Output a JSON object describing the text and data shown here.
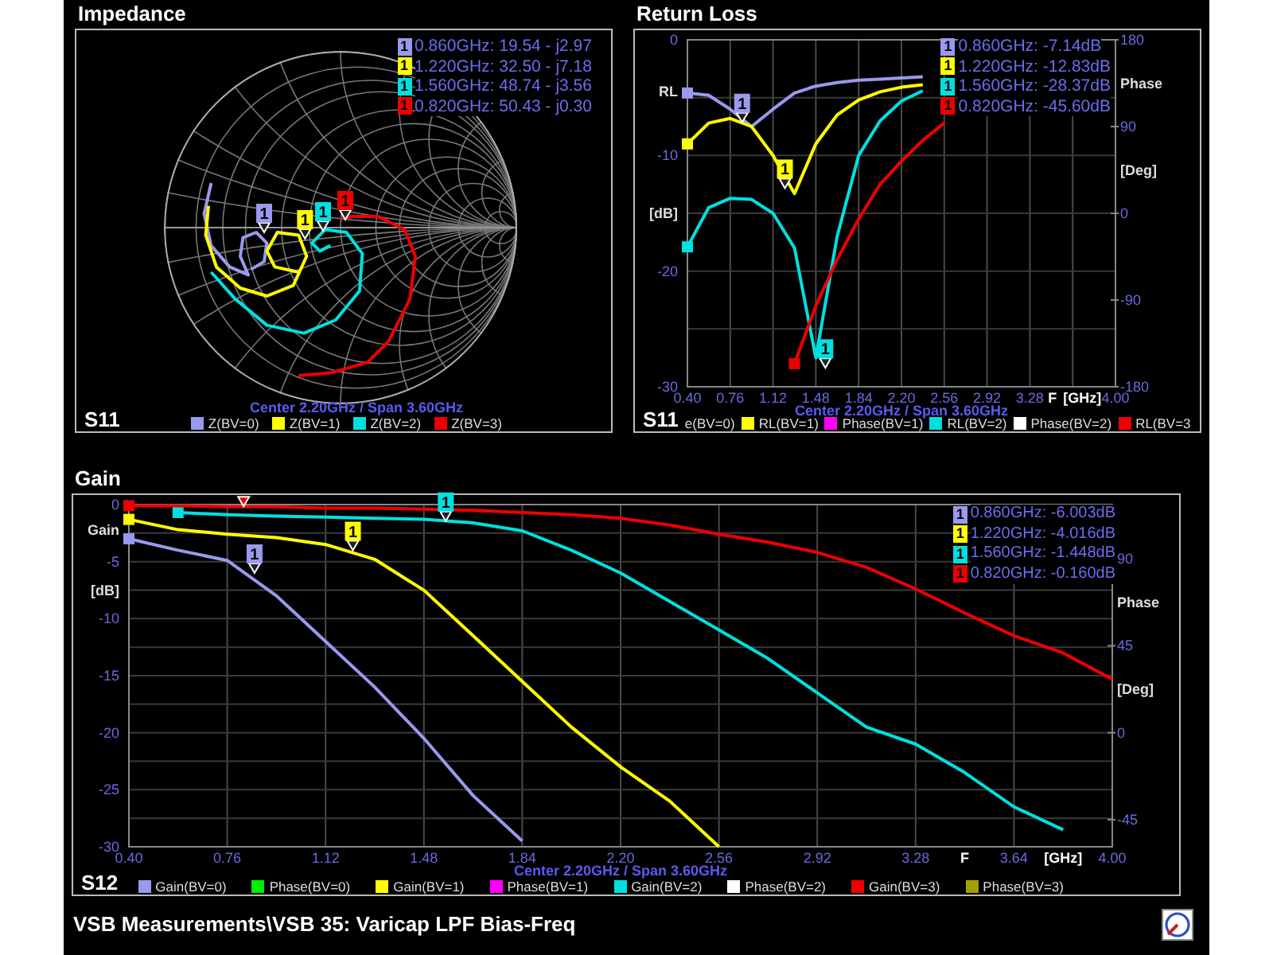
{
  "impedance": {
    "title": "Impedance",
    "param": "S11",
    "readouts": [
      {
        "marker": "1",
        "color": "#9999ee",
        "text": "0.860GHz: 19.54 - j2.97"
      },
      {
        "marker": "1",
        "color": "#ffff00",
        "text": "1.220GHz: 32.50 - j7.18"
      },
      {
        "marker": "1",
        "color": "#00e0e0",
        "text": "1.560GHz: 48.74 - j3.56"
      },
      {
        "marker": "1",
        "color": "#ee0000",
        "text": "0.820GHz: 50.43 - j0.30"
      }
    ],
    "flags": [
      {
        "label": "1",
        "color": "#9999ee"
      },
      {
        "label": "1",
        "color": "#ffff00"
      },
      {
        "label": "1",
        "color": "#00e0e0"
      },
      {
        "label": "1",
        "color": "#ee0000"
      }
    ],
    "span_text": "Center 2.20GHz / Span 3.60GHz",
    "legend": [
      {
        "label": "Z(BV=0)",
        "color": "#9999ee"
      },
      {
        "label": "Z(BV=1)",
        "color": "#ffff00"
      },
      {
        "label": "Z(BV=2)",
        "color": "#00e0e0"
      },
      {
        "label": "Z(BV=3)",
        "color": "#ee0000"
      }
    ]
  },
  "return_loss": {
    "title": "Return Loss",
    "param": "S11",
    "y_symbol": "RL",
    "x_symbol": "F",
    "y2_symbol": "Phase",
    "y2_unit": "[Deg]",
    "readouts": [
      {
        "marker": "1",
        "color": "#9999ee",
        "text": "0.860GHz: -7.14dB"
      },
      {
        "marker": "1",
        "color": "#ffff00",
        "text": "1.220GHz: -12.83dB"
      },
      {
        "marker": "1",
        "color": "#00e0e0",
        "text": "1.560GHz: -28.37dB"
      },
      {
        "marker": "1",
        "color": "#ee0000",
        "text": "0.820GHz: -45.60dB"
      }
    ],
    "flags": [
      {
        "label": "1",
        "color": "#9999ee"
      },
      {
        "label": "1",
        "color": "#ffff00"
      },
      {
        "label": "1",
        "color": "#00e0e0"
      }
    ],
    "span_text": "Center 2.20GHz / Span 3.60GHz",
    "legend": [
      {
        "label": "e(BV=0)"
      },
      {
        "label": "RL(BV=1)",
        "color": "#ffff00"
      },
      {
        "label": "Phase(BV=1)",
        "color": "#ff00ff"
      },
      {
        "label": "RL(BV=2)",
        "color": "#00e0e0"
      },
      {
        "label": "Phase(BV=2)",
        "color": "#ffffff"
      },
      {
        "label": "RL(BV=3",
        "color": "#ee0000"
      }
    ],
    "chart_data": {
      "type": "line",
      "xlabel": "[GHz]",
      "ylabel": "[dB]",
      "grid": true,
      "x": [
        0.4,
        0.58,
        0.76,
        0.94,
        1.12,
        1.3,
        1.48,
        1.66,
        1.84,
        2.02,
        2.2,
        2.38,
        2.56
      ],
      "series": [
        {
          "color": "#9999ee",
          "values": [
            -4.6,
            -4.8,
            -6.0,
            -7.5,
            -6.0,
            -4.6,
            -4.0,
            -3.7,
            -3.5,
            -3.4,
            -3.3,
            -3.2,
            null
          ]
        },
        {
          "color": "#ffff00",
          "values": [
            -9.0,
            -7.2,
            -6.8,
            -7.5,
            -10.0,
            -13.3,
            -9.0,
            -6.5,
            -5.2,
            -4.5,
            -4.1,
            -3.9,
            null
          ]
        },
        {
          "color": "#00e0e0",
          "values": [
            -17.9,
            -14.5,
            -13.7,
            -13.8,
            -15.0,
            -18.0,
            -27.5,
            -17.0,
            -10.0,
            -7.0,
            -5.3,
            -4.4,
            null
          ]
        },
        {
          "color": "#ee0000",
          "values": [
            null,
            null,
            null,
            null,
            null,
            -28.0,
            -23.0,
            -19.0,
            -15.5,
            -12.5,
            -10.5,
            -8.7,
            -7.2
          ]
        }
      ],
      "xlim": [
        0.4,
        4.0
      ],
      "ylim": [
        -30,
        0
      ],
      "xticks": [
        {
          "value": 0.4,
          "label": "0.40"
        },
        {
          "value": 0.76,
          "label": "0.76"
        },
        {
          "value": 1.12,
          "label": "1.12"
        },
        {
          "value": 1.48,
          "label": "1.48"
        },
        {
          "value": 1.84,
          "label": "1.84"
        },
        {
          "value": 2.2,
          "label": "2.20"
        },
        {
          "value": 2.56,
          "label": "2.56"
        },
        {
          "value": 2.92,
          "label": "2.92"
        },
        {
          "value": 3.28,
          "label": "3.28"
        },
        {
          "value": 4.0,
          "label": "4.00"
        }
      ],
      "yticks": [
        0,
        -10,
        -20,
        -30
      ],
      "y2lim": [
        -180,
        180
      ],
      "y2ticks": [
        180,
        90,
        0,
        -90,
        -180
      ]
    }
  },
  "gain": {
    "title": "Gain",
    "param": "S12",
    "y_symbol": "Gain",
    "x_symbol": "F",
    "y2_symbol": "Phase",
    "y2_unit": "[Deg]",
    "readouts": [
      {
        "marker": "1",
        "color": "#9999ee",
        "text": "0.860GHz: -6.003dB"
      },
      {
        "marker": "1",
        "color": "#ffff00",
        "text": "1.220GHz: -4.016dB"
      },
      {
        "marker": "1",
        "color": "#00e0e0",
        "text": "1.560GHz: -1.448dB"
      },
      {
        "marker": "1",
        "color": "#ee0000",
        "text": "0.820GHz: -0.160dB"
      }
    ],
    "flags": [
      {
        "label": "1",
        "color": "#9999ee"
      },
      {
        "label": "1",
        "color": "#ffff00"
      },
      {
        "label": "1",
        "color": "#00e0e0"
      },
      {
        "color": "#ee0000"
      }
    ],
    "span_text": "Center 2.20GHz / Span 3.60GHz",
    "legend": [
      {
        "label": "Gain(BV=0)",
        "color": "#9999ee"
      },
      {
        "label": "Phase(BV=0)",
        "color": "#00ee00"
      },
      {
        "label": "Gain(BV=1)",
        "color": "#ffff00"
      },
      {
        "label": "Phase(BV=1)",
        "color": "#ff00ff"
      },
      {
        "label": "Gain(BV=2)",
        "color": "#00e0e0"
      },
      {
        "label": "Phase(BV=2)",
        "color": "#ffffff"
      },
      {
        "label": "Gain(BV=3)",
        "color": "#ee0000"
      },
      {
        "label": "Phase(BV=3)",
        "color": "#a0a000"
      }
    ],
    "chart_data": {
      "type": "line",
      "xlabel": "[GHz]",
      "ylabel": "[dB]",
      "grid": true,
      "x": [
        0.4,
        0.58,
        0.76,
        0.94,
        1.12,
        1.3,
        1.48,
        1.66,
        1.84,
        2.02,
        2.2,
        2.38,
        2.56,
        2.74,
        2.92,
        3.1,
        3.28,
        3.46,
        3.64,
        3.82,
        4.0
      ],
      "series": [
        {
          "color": "#9999ee",
          "values": [
            -3.0,
            -4.0,
            -4.9,
            -8.0,
            -12.0,
            -16.0,
            -20.5,
            -25.5,
            -29.5,
            null,
            null,
            null,
            null,
            null,
            null,
            null,
            null,
            null,
            null,
            null,
            null
          ]
        },
        {
          "color": "#ffff00",
          "values": [
            -1.3,
            -2.2,
            -2.6,
            -2.9,
            -3.5,
            -4.8,
            -7.5,
            -11.5,
            -15.5,
            -19.5,
            -23.0,
            -26.0,
            -30.0,
            null,
            null,
            null,
            null,
            null,
            null,
            null,
            null
          ]
        },
        {
          "color": "#00e0e0",
          "values": [
            null,
            -0.7,
            -0.9,
            -1.0,
            -1.1,
            -1.2,
            -1.3,
            -1.6,
            -2.3,
            -4.0,
            -6.0,
            -8.5,
            -11.0,
            -13.5,
            -16.5,
            -19.5,
            -21.0,
            -23.5,
            -26.5,
            -28.5,
            null
          ]
        },
        {
          "color": "#ee0000",
          "values": [
            -0.1,
            -0.1,
            -0.2,
            -0.2,
            -0.3,
            -0.3,
            -0.4,
            -0.5,
            -0.7,
            -0.9,
            -1.2,
            -1.8,
            -2.6,
            -3.3,
            -4.2,
            -5.5,
            -7.4,
            -9.5,
            -11.5,
            -13.0,
            -15.3
          ]
        }
      ],
      "xlim": [
        0.4,
        4.0
      ],
      "ylim": [
        -30,
        0
      ],
      "xticks": [
        {
          "value": 0.4,
          "label": "0.40"
        },
        {
          "value": 0.76,
          "label": "0.76"
        },
        {
          "value": 1.12,
          "label": "1.12"
        },
        {
          "value": 1.48,
          "label": "1.48"
        },
        {
          "value": 1.84,
          "label": "1.84"
        },
        {
          "value": 2.2,
          "label": "2.20"
        },
        {
          "value": 2.56,
          "label": "2.56"
        },
        {
          "value": 2.92,
          "label": "2.92"
        },
        {
          "value": 3.28,
          "label": "3.28"
        },
        {
          "value": 3.64,
          "label": "3.64"
        },
        {
          "value": 4.0,
          "label": "4.00"
        }
      ],
      "yticks": [
        0,
        -5,
        -10,
        -15,
        -20,
        -25,
        -30
      ],
      "y2lim": [
        -59,
        118
      ],
      "y2ticks": [
        90,
        45,
        0,
        -45
      ]
    }
  },
  "footer": {
    "title": "VSB Measurements\\VSB 35: Varicap LPF Bias-Freq"
  }
}
